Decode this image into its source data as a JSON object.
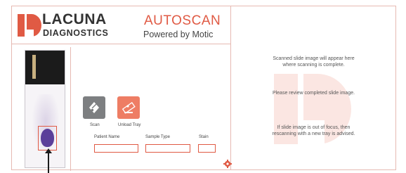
{
  "header": {
    "brand_name": "LACUNA",
    "brand_sub": "DIAGNOSTICS",
    "product": "AUTOSCAN",
    "powered_by": "Powered by Motic"
  },
  "colors": {
    "accent": "#e05a44",
    "border": "#e6b9b2",
    "scan_button": "#7d7f81",
    "unload_button": "#ee7d64"
  },
  "controls": {
    "scan_label": "Scan",
    "unload_label": "Unload Tray",
    "scan_icon": "scan-icon",
    "unload_icon": "eject-slide-icon"
  },
  "form": {
    "patient_label": "Patient Name",
    "sample_label": "Sample Type",
    "stain_label": "Stain",
    "patient_value": "",
    "sample_value": "",
    "stain_value": ""
  },
  "preview": {
    "line1": "Scanned slide image will appear here",
    "line2": "where scanning is complete.",
    "line3": "Please review completed slide image.",
    "line4": "If slide image is out of focus, then",
    "line5": "rescanning with a new tray is advised."
  }
}
